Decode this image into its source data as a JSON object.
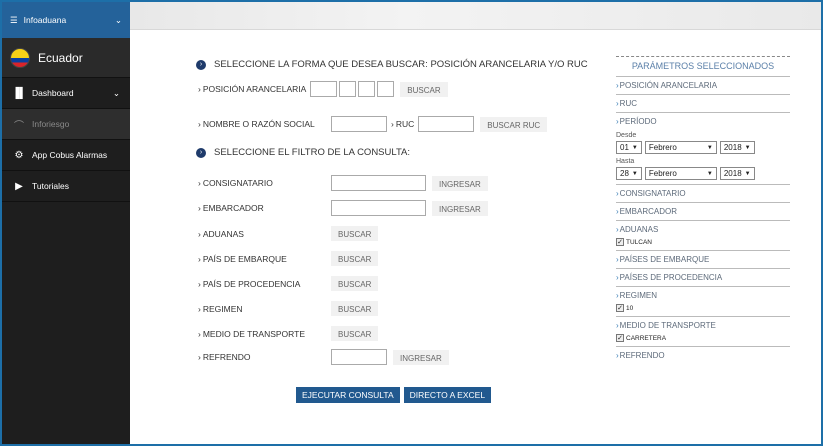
{
  "sidebar": {
    "top_label": "Infoaduana",
    "logo_label": "Ecuador",
    "items": [
      {
        "label": "Dashboard",
        "icon": "bar-chart-icon",
        "glyph": "▐▌"
      },
      {
        "label": "Inforiesgo",
        "icon": "gauge-icon",
        "glyph": "⌒"
      },
      {
        "label": "App Cobus Alarmas",
        "icon": "gear-icon",
        "glyph": "⚙"
      },
      {
        "label": "Tutoriales",
        "icon": "play-icon",
        "glyph": "▶"
      }
    ]
  },
  "search": {
    "heading": "SELECCIONE LA FORMA QUE DESEA BUSCAR: POSICIÓN ARANCELARIA Y/O RUC",
    "posicion_label": "POSICIÓN ARANCELARIA",
    "buscar_label": "BUSCAR",
    "nombre_label": "NOMBRE O RAZÓN SOCIAL",
    "ruc_label": "RUC",
    "buscar_ruc_label": "BUSCAR RUC"
  },
  "filter": {
    "heading": "SELECCIONE EL FILTRO DE LA CONSULTA:",
    "consignatario": "CONSIGNATARIO",
    "embarcador": "EMBARCADOR",
    "aduanas": "ADUANAS",
    "pais_embarque": "PAÍS DE EMBARQUE",
    "pais_procedencia": "PAÍS DE PROCEDENCIA",
    "regimen": "REGIMEN",
    "medio_transporte": "MEDIO DE TRANSPORTE",
    "refrendo": "REFRENDO",
    "ingresar": "INGRESAR",
    "buscar": "BUSCAR",
    "ejecutar": "EJECUTAR CONSULTA",
    "excel": "DIRECTO A EXCEL"
  },
  "params": {
    "title": "PARÁMETROS SELECCIONADOS",
    "posicion": "POSICIÓN ARANCELARIA",
    "ruc": "RUC",
    "periodo": "PERÍODO",
    "desde": "Desde",
    "desde_day": "01",
    "desde_month": "Febrero",
    "desde_year": "2018",
    "hasta": "Hasta",
    "hasta_day": "28",
    "hasta_month": "Febrero",
    "hasta_year": "2018",
    "consignatario": "CONSIGNATARIO",
    "embarcador": "EMBARCADOR",
    "aduanas": "ADUANAS",
    "aduanas_value": "TULCAN",
    "paises_embarque": "PAÍSES DE EMBARQUE",
    "paises_procedencia": "PAÍSES DE PROCEDENCIA",
    "regimen": "REGIMEN",
    "regimen_value": "10",
    "medio": "MEDIO DE TRANSPORTE",
    "medio_value": "CARRETERA",
    "refrendo": "REFRENDO"
  },
  "colors": {
    "sidebar_top": "#24629a",
    "sidebar": "#1e1e1e",
    "button": "#21598f",
    "frame": "#1d6fa8"
  }
}
